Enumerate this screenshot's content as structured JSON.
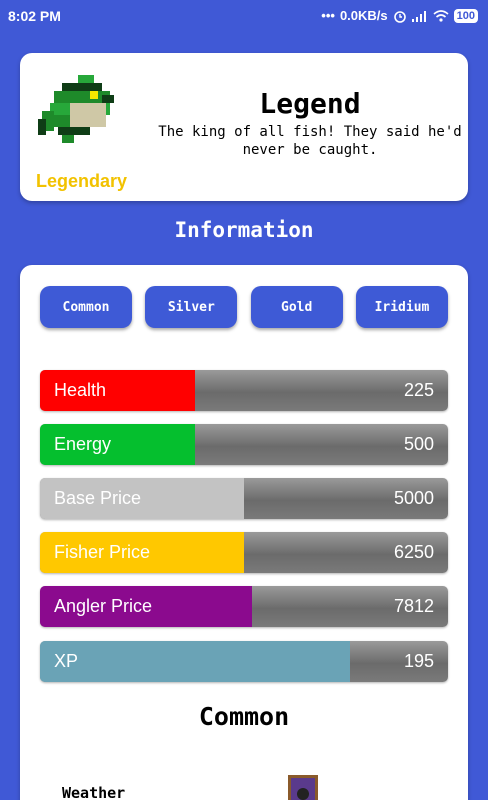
{
  "status": {
    "time": "8:02 PM",
    "net_speed": "0.0KB/s",
    "battery": "100"
  },
  "fish": {
    "name": "Legend",
    "description": "The king of all fish! They said he'd never be caught.",
    "rarity": "Legendary"
  },
  "info_title": "Information",
  "quality_tabs": [
    "Common",
    "Silver",
    "Gold",
    "Iridium"
  ],
  "stats": [
    {
      "label": "Health",
      "value": "225",
      "fill_fraction": 0.38,
      "color": "#ff0000"
    },
    {
      "label": "Energy",
      "value": "500",
      "fill_fraction": 0.38,
      "color": "#05bf2e"
    },
    {
      "label": "Base Price",
      "value": "5000",
      "fill_fraction": 0.5,
      "color": "#c3c3c3"
    },
    {
      "label": "Fisher Price",
      "value": "6250",
      "fill_fraction": 0.5,
      "color": "#ffc800"
    },
    {
      "label": "Angler Price",
      "value": "7812",
      "fill_fraction": 0.52,
      "color": "#8b0a8e"
    },
    {
      "label": "XP",
      "value": "195",
      "fill_fraction": 0.76,
      "color": "#6aa3b6"
    }
  ],
  "section_title": "Common",
  "weather_label": "Weather",
  "colors": {
    "background": "#4059d6",
    "tab": "#3e5ad6",
    "rarity": "#f2c200"
  }
}
